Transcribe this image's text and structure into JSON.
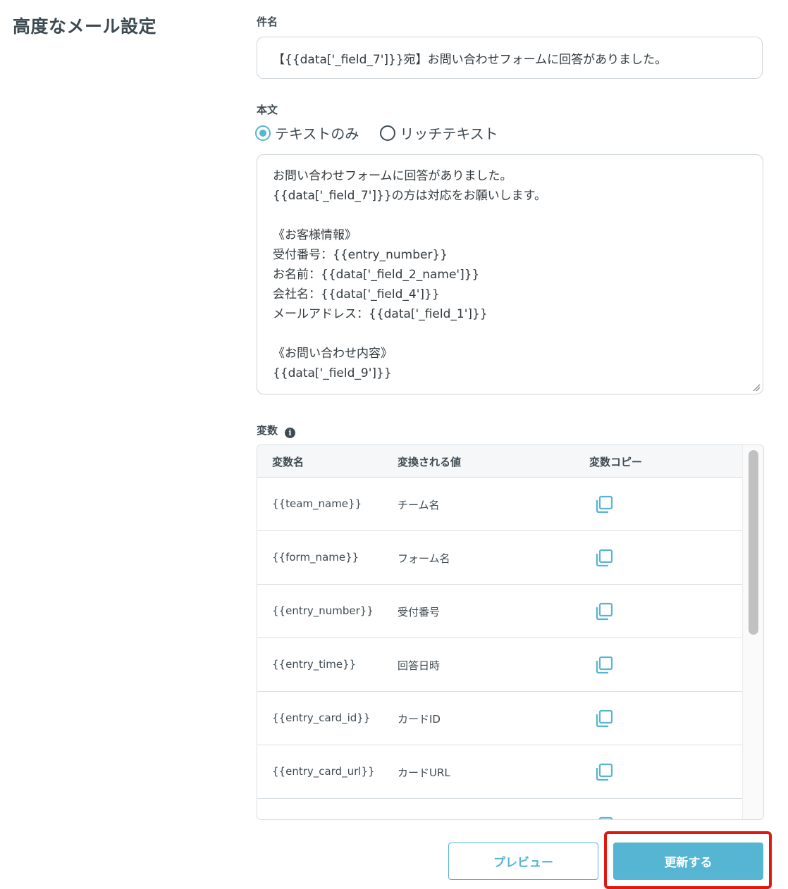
{
  "section_title": "高度なメール設定",
  "subject": {
    "label": "件名",
    "value": "【{{data['_field_7']}}宛】お問い合わせフォームに回答がありました。"
  },
  "body": {
    "label": "本文",
    "format_options": [
      {
        "label": "テキストのみ",
        "checked": true
      },
      {
        "label": "リッチテキスト",
        "checked": false
      }
    ],
    "lines": [
      "お問い合わせフォームに回答がありました。",
      "{{data['_field_7']}}の方は対応をお願いします。",
      "",
      "《お客様情報》",
      "受付番号：{{entry_number}}",
      "お名前：{{data['_field_2_name']}}",
      "会社名：{{data['_field_4']}}",
      "メールアドレス：{{data['_field_1']}}",
      "",
      "《お問い合わせ内容》",
      "{{data['_field_9']}}"
    ]
  },
  "variables": {
    "label": "変数",
    "info_icon": "i",
    "columns": [
      "変数名",
      "変換される値",
      "変数コピー"
    ],
    "rows": [
      {
        "name": "{{team_name}}",
        "value": "チーム名"
      },
      {
        "name": "{{form_name}}",
        "value": "フォーム名"
      },
      {
        "name": "{{entry_number}}",
        "value": "受付番号"
      },
      {
        "name": "{{entry_time}}",
        "value": "回答日時"
      },
      {
        "name": "{{entry_card_id}}",
        "value": "カードID"
      },
      {
        "name": "{{entry_card_url}}",
        "value": "カードURL"
      }
    ]
  },
  "buttons": {
    "preview": "プレビュー",
    "update": "更新する"
  },
  "colors": {
    "accent": "#56b5d2",
    "highlight": "#e0190f",
    "text": "#3e4a52"
  }
}
